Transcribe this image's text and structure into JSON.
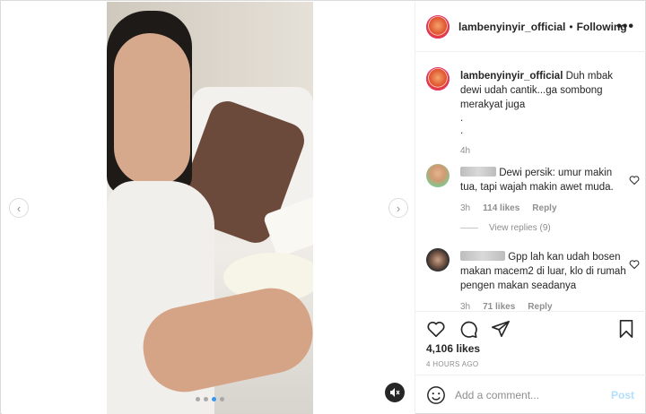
{
  "post": {
    "username": "lambenyinyir_official",
    "separator": "•",
    "follow_status": "Following",
    "more_label": "•••"
  },
  "caption": {
    "username": "lambenyinyir_official",
    "text": "Duh mbak dewi udah cantik...ga sombong merakyat juga",
    "dot1": ".",
    "dot2": ".",
    "time": "4h"
  },
  "comments": [
    {
      "text": "Dewi persik: umur makin tua, tapi wajah makin awet muda.",
      "time": "3h",
      "likes": "114 likes",
      "reply": "Reply"
    },
    {
      "text": "Gpp lah kan udah bosen makan macem2 di luar, klo di rumah pengen makan seadanya",
      "time": "3h",
      "likes": "71 likes",
      "reply": "Reply"
    }
  ],
  "view_replies": "View replies (9)",
  "likes_count": "4,106 likes",
  "timestamp": "4 HOURS AGO",
  "add_comment": {
    "placeholder": "Add a comment...",
    "post_label": "Post"
  },
  "icons": {
    "prev": "chevron-left-icon",
    "next": "chevron-right-icon",
    "mute": "speaker-muted-icon",
    "heart": "heart-icon",
    "comment": "comment-icon",
    "share": "share-icon",
    "save": "bookmark-icon",
    "emoji": "emoji-icon"
  },
  "colors": {
    "link": "#3897f0",
    "post_disabled": "#b2dffc",
    "muted_text": "#8e8e8e"
  },
  "carousel": {
    "slides": 4,
    "active": 3
  }
}
